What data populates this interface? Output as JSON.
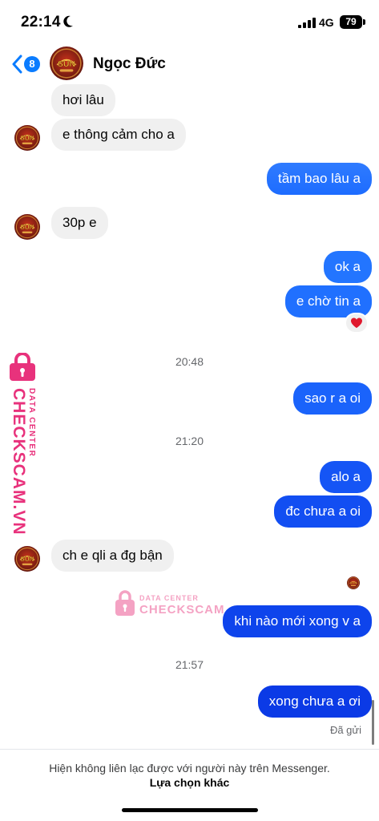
{
  "status_bar": {
    "time": "22:14",
    "network": "4G",
    "battery": "79",
    "icons": [
      "moon-icon",
      "signal-icon",
      "battery-icon"
    ]
  },
  "header": {
    "back_count": "8",
    "contact_name": "Ngọc Đức",
    "avatar_text": "SUN",
    "icons": [
      "back-chevron-icon",
      "contact-avatar"
    ]
  },
  "colors": {
    "outgoing_top": "#1d74ff",
    "outgoing_bottom": "#0a36e0",
    "incoming": "#f0f0f0",
    "badge": "#0a7cff",
    "watermark": "#e8327c"
  },
  "conversation": {
    "messages": [
      {
        "dir": "in",
        "text": "hơi lâu"
      },
      {
        "dir": "in",
        "text": "e thông cảm cho a"
      },
      {
        "dir": "out",
        "text": "tầm bao lâu a"
      },
      {
        "dir": "in",
        "text": "30p e"
      },
      {
        "dir": "out",
        "text": "ok a"
      },
      {
        "dir": "out",
        "text": "e chờ tin a",
        "reaction": "heart-icon"
      },
      {
        "dir": "out",
        "text": "sao r a oi"
      },
      {
        "dir": "out",
        "text": "alo a"
      },
      {
        "dir": "out",
        "text": "đc chưa a oi"
      },
      {
        "dir": "in",
        "text": "ch e qli a đg bận"
      },
      {
        "dir": "out",
        "text": "khi nào mới xong v a"
      },
      {
        "dir": "out",
        "text": "xong chưa a ơi"
      }
    ],
    "time_separators": [
      "20:48",
      "21:20",
      "21:57"
    ],
    "sent_status": "Đã gửi"
  },
  "footer": {
    "notice": "Hiện không liên lạc được với người này trên Messenger.",
    "link": "Lựa chọn khác"
  },
  "watermark": {
    "brand": "CHECKSCAM.VN",
    "center_brand": "CHECKSCAM",
    "subtitle": "DATA CENTER"
  }
}
